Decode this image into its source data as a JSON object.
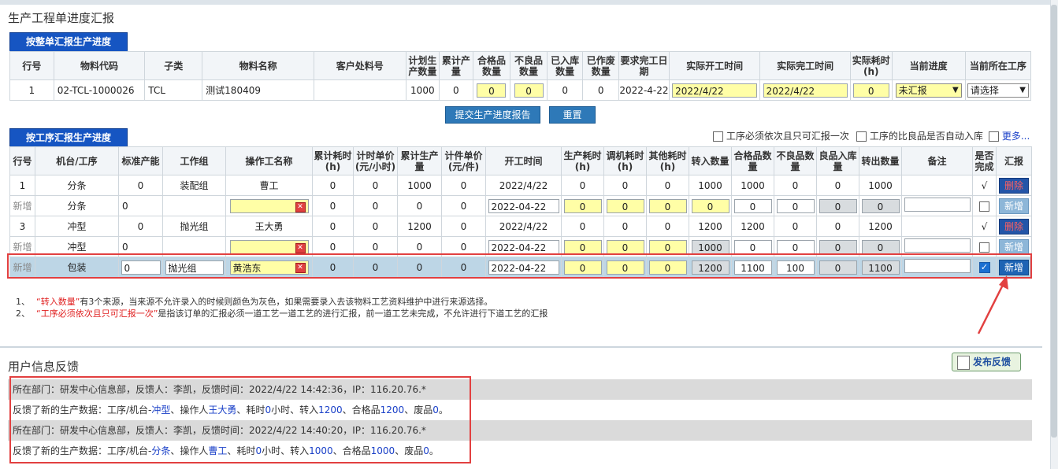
{
  "page_title": "生产工程单进度汇报",
  "order_tab": "按整单汇报生产进度",
  "order_table": {
    "headers": [
      "行号",
      "物料代码",
      "子类",
      "物料名称",
      "客户处料号",
      "计划生产数量",
      "累计产量",
      "合格品数量",
      "不良品数量",
      "已入库数量",
      "已作废数量",
      "要求完工日期",
      "实际开工时间",
      "实际完工时间",
      "实际耗时(h)",
      "当前进度",
      "当前所在工序"
    ],
    "row": {
      "line": "1",
      "code": "02-TCL-1000026",
      "sub": "TCL",
      "name": "测试180409",
      "cust": "",
      "plan": "1000",
      "cum": "0",
      "good": "0",
      "bad": "0",
      "stored": "0",
      "void": "0",
      "due": "2022-4-22",
      "start": "2022/4/22",
      "finish": "2022/4/22",
      "hours": "0",
      "progress": "未汇报",
      "process": "请选择"
    }
  },
  "submit_btn": "提交生产进度报告",
  "reset_btn": "重置",
  "process_tab": "按工序汇报生产进度",
  "options": {
    "opt1": "工序必须依次且只可汇报一次",
    "opt2": "工序的比良品是否自动入库",
    "more": "更多..."
  },
  "process_table": {
    "headers": [
      "行号",
      "机台/工序",
      "标准产能",
      "工作组",
      "操作工名称",
      "累计耗时(h)",
      "计时单价(元/小时)",
      "累计生产量",
      "计件单价(元/件)",
      "开工时间",
      "生产耗时(h)",
      "调机耗时(h)",
      "其他耗时(h)",
      "转入数量",
      "合格品数量",
      "不良品数量",
      "良品入库量",
      "转出数量",
      "备注",
      "是否完成",
      "汇报"
    ],
    "rows": [
      {
        "line": "1",
        "proc": "分条",
        "cap": "0",
        "group": "装配组",
        "worker": "曹工",
        "cum_h": "0",
        "rate_h": "0",
        "cum_qty": "1000",
        "rate_p": "0",
        "start": "2022/4/22",
        "prod_h": "0",
        "adj_h": "0",
        "oth_h": "0",
        "in": "1000",
        "good": "1000",
        "bad": "0",
        "stock": "0",
        "out": "1000",
        "done": "√",
        "action": "删除"
      },
      {
        "line": "新增",
        "proc": "分条",
        "cap": "0",
        "group": "",
        "worker": "",
        "cum_h": "0",
        "rate_h": "0",
        "cum_qty": "0",
        "rate_p": "0",
        "start": "2022-04-22",
        "prod_h": "0",
        "adj_h": "0",
        "oth_h": "0",
        "in": "0",
        "good": "0",
        "bad": "0",
        "stock": "0",
        "out": "0",
        "done": "",
        "action": "新增"
      },
      {
        "line": "3",
        "proc": "冲型",
        "cap": "0",
        "group": "抛光组",
        "worker": "王大勇",
        "cum_h": "0",
        "rate_h": "0",
        "cum_qty": "1200",
        "rate_p": "0",
        "start": "2022/4/22",
        "prod_h": "0",
        "adj_h": "0",
        "oth_h": "0",
        "in": "1200",
        "good": "1200",
        "bad": "0",
        "stock": "0",
        "out": "1200",
        "done": "√",
        "action": "删除"
      },
      {
        "line": "新增",
        "proc": "冲型",
        "cap": "0",
        "group": "",
        "worker": "",
        "cum_h": "0",
        "rate_h": "0",
        "cum_qty": "0",
        "rate_p": "0",
        "start": "2022-04-22",
        "prod_h": "0",
        "adj_h": "0",
        "oth_h": "0",
        "in": "1000",
        "good": "0",
        "bad": "0",
        "stock": "0",
        "out": "0",
        "done": "",
        "action": "新增"
      },
      {
        "line": "新增",
        "proc": "包装",
        "cap": "0",
        "group": "抛光组",
        "worker": "黄浩东",
        "cum_h": "0",
        "rate_h": "0",
        "cum_qty": "0",
        "rate_p": "0",
        "start": "2022-04-22",
        "prod_h": "0",
        "adj_h": "0",
        "oth_h": "0",
        "in": "1200",
        "good": "1100",
        "bad": "100",
        "stock": "0",
        "out": "1100",
        "done": "checked",
        "action": "新增"
      }
    ]
  },
  "notes": {
    "n1_idx": "1、",
    "n1_red": "“转入数量”",
    "n1_text": "有3个来源，当来源不允许录入的时候则颜色为灰色，如果需要录入去该物料工艺资料维护中进行来源选择。",
    "n2_idx": "2、",
    "n2_red": "“工序必须依次且只可汇报一次”",
    "n2_text": "是指该订单的汇报必须一道工艺一道工艺的进行汇报，前一道工艺未完成，不允许进行下道工艺的汇报"
  },
  "feedback": {
    "title": "用户信息反馈",
    "publish_btn": "发布反馈",
    "entries": [
      {
        "head": "所在部门：研发中心信息部，反馈人：李凯，反馈时间：2022/4/22 14:42:36，IP：116.20.76.*",
        "prefix": "反馈了新的生产数据：工序/机台-",
        "proc": "冲型",
        "t1": "、操作人",
        "worker": "王大勇",
        "t2": "、耗时",
        "hours": "0",
        "t3": "小时、转入",
        "in": "1200",
        "t4": "、合格品",
        "good": "1200",
        "t5": "、废品",
        "scrap": "0",
        "t6": "。"
      },
      {
        "head": "所在部门：研发中心信息部，反馈人：李凯，反馈时间：2022/4/22 14:40:20，IP：116.20.76.*",
        "prefix": "反馈了新的生产数据：工序/机台-",
        "proc": "分条",
        "t1": "、操作人",
        "worker": "曹工",
        "t2": "、耗时",
        "hours": "0",
        "t3": "小时、转入",
        "in": "1000",
        "t4": "、合格品",
        "good": "1000",
        "t5": "、废品",
        "scrap": "0",
        "t6": "。"
      }
    ]
  },
  "colors": {
    "accent": "#1655c2",
    "input_yellow": "#fffea6",
    "highlight_row": "#bdd6e6",
    "annotation_red": "#e24040"
  }
}
